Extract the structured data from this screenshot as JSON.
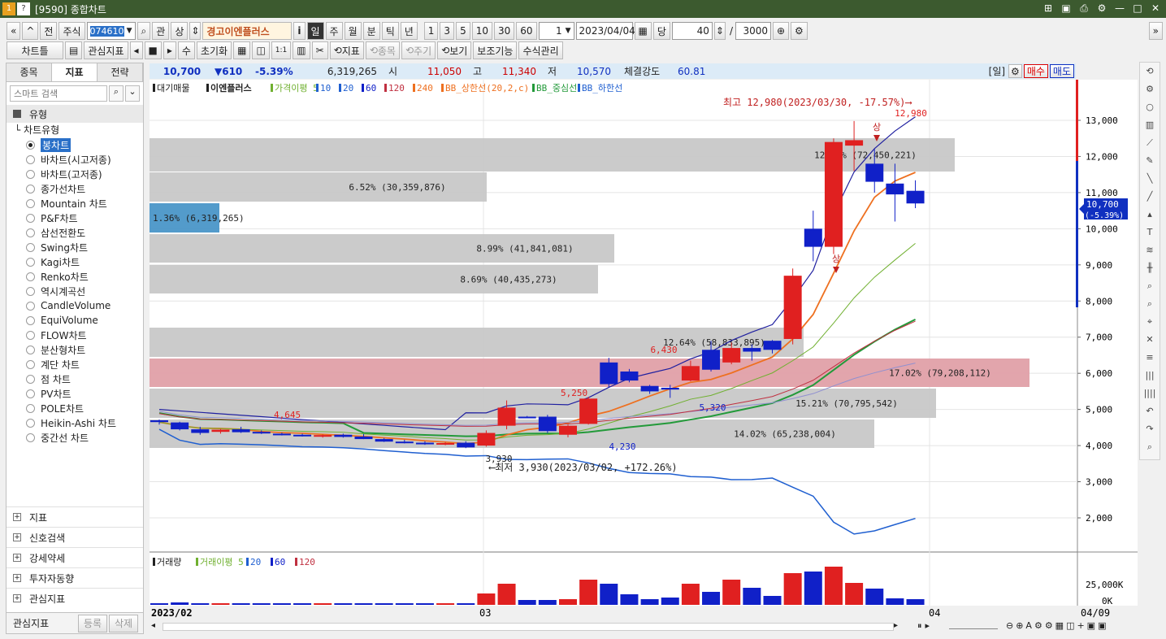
{
  "window": {
    "title": "[9590] 종합차트",
    "badge1": "1",
    "badge2": "?"
  },
  "toolbar1": {
    "nav_prev": "«",
    "nav_up": "^",
    "btn_prev": "전",
    "market": "주식",
    "code": "074610",
    "btn_search": "⌕",
    "btn_gwan": "관",
    "btn_sang": "상",
    "stock_name": "경고이엔플러스",
    "btn_info": "i",
    "periods": [
      "일",
      "주",
      "월",
      "분",
      "틱",
      "년"
    ],
    "active_period": "일",
    "intervals": [
      "1",
      "3",
      "5",
      "10",
      "30",
      "60"
    ],
    "interval_value": "1",
    "date": "2023/04/04",
    "dang": "당",
    "count": "40",
    "total": "3000"
  },
  "toolbar2": {
    "chart_type": "차트틀",
    "fav_indicator": "관심지표",
    "su": "수",
    "init": "초기화",
    "btn_11": "1:1",
    "btn_indicator": "지표",
    "btn_jongmok": "종목",
    "btn_jugi": "주기",
    "btn_view": "보기",
    "btn_aux": "보조기능",
    "btn_formula": "수식관리"
  },
  "left": {
    "tabs": [
      "종목",
      "지표",
      "전략"
    ],
    "active_tab": "지표",
    "search_placeholder": "스마트 검색",
    "group_title": "유형",
    "tree_root": "차트유형",
    "items": [
      "봉차트",
      "바차트(시고저종)",
      "바차트(고저종)",
      "종가선차트",
      "Mountain 차트",
      "P&F차트",
      "삼선전환도",
      "Swing차트",
      "Kagi차트",
      "Renko차트",
      "역시계곡선",
      "CandleVolume",
      "EquiVolume",
      "FLOW차트",
      "분산형차트",
      "계단 차트",
      "점 차트",
      "PV차트",
      "POLE차트",
      "Heikin-Ashi 차트",
      "중간선 차트"
    ],
    "selected": "봉차트",
    "groups": [
      "지표",
      "신호검색",
      "강세약세",
      "투자자동향",
      "관심지표"
    ],
    "fav_label": "관심지표",
    "fav_register": "등록",
    "fav_delete": "삭제"
  },
  "infobar": {
    "price": "10,700",
    "change": "▼610",
    "pct": "-5.39%",
    "volume": "6,319,265",
    "open_label": "시",
    "open": "11,050",
    "high_label": "고",
    "high": "11,340",
    "low_label": "저",
    "low": "10,570",
    "strength_label": "체결강도",
    "strength": "60.81",
    "period_badge": "[일]",
    "buy": "매수",
    "sell": "매도"
  },
  "legend": {
    "items": [
      "대기매물",
      "이엔플러스",
      "가격이평 5",
      "10",
      "20",
      "60",
      "120",
      "240",
      "BB_상한선(20,2,c)",
      "BB_중심선",
      "BB_하한선"
    ]
  },
  "annotations": {
    "high_text": "최고 12,980(2023/03/30, -17.57%)⟶",
    "low_text": "⟵최저 3,930(2023/03/02, +172.26%)",
    "sang": "상",
    "current_price": "10,700",
    "current_pct": "(-5.39%)"
  },
  "bars": [
    {
      "pct": "12.44% (72,450,221)",
      "v": 12.44
    },
    {
      "pct": "6.52% (30,359,876)",
      "v": 6.52
    },
    {
      "pct": "1.36% (6,319,265)",
      "v": 1.36
    },
    {
      "pct": "8.99% (41,841,081)",
      "v": 8.99
    },
    {
      "pct": "8.69% (40,435,273)",
      "v": 8.69
    },
    {
      "pct": "12.64% (58,833,895)",
      "v": 12.64
    },
    {
      "pct": "17.02% (79,208,112)",
      "v": 17.02
    },
    {
      "pct": "15.21% (70,795,542)",
      "v": 15.21
    },
    {
      "pct": "14.02% (65,238,004)",
      "v": 14.02
    }
  ],
  "price_labels": [
    "4,645",
    "5,250",
    "3,930",
    "6,430",
    "4,230",
    "5,320",
    "12,980"
  ],
  "yaxis": [
    "13,000",
    "12,000",
    "11,000",
    "10,000",
    "9,000",
    "8,000",
    "7,000",
    "6,000",
    "5,000",
    "4,000",
    "3,000",
    "2,000"
  ],
  "volume": {
    "legend": [
      "거래량",
      "거래이평 5",
      "20",
      "60",
      "120"
    ],
    "axis": [
      "25,000K",
      "0K"
    ]
  },
  "xaxis": [
    "2023/02",
    "03",
    "04",
    "04/09"
  ],
  "chart_data": {
    "type": "candlestick",
    "candles": [
      [
        4700,
        4720,
        4580,
        4650
      ],
      [
        4640,
        4660,
        4420,
        4450
      ],
      [
        4450,
        4520,
        4300,
        4350
      ],
      [
        4380,
        4460,
        4330,
        4440
      ],
      [
        4450,
        4520,
        4350,
        4370
      ],
      [
        4380,
        4420,
        4320,
        4340
      ],
      [
        4330,
        4360,
        4280,
        4300
      ],
      [
        4300,
        4330,
        4250,
        4260
      ],
      [
        4260,
        4310,
        4220,
        4290
      ],
      [
        4300,
        4330,
        4220,
        4240
      ],
      [
        4250,
        4320,
        4180,
        4180
      ],
      [
        4180,
        4210,
        4100,
        4110
      ],
      [
        4110,
        4160,
        4060,
        4080
      ],
      [
        4080,
        4120,
        4020,
        4050
      ],
      [
        4040,
        4100,
        4010,
        4070
      ],
      [
        4080,
        4120,
        3930,
        3950
      ],
      [
        4000,
        4420,
        3970,
        4350
      ],
      [
        4550,
        5250,
        4450,
        5050
      ],
      [
        4800,
        4820,
        4760,
        4780
      ],
      [
        4800,
        4850,
        4350,
        4400
      ],
      [
        4300,
        4580,
        4230,
        4550
      ],
      [
        4600,
        5350,
        4580,
        5300
      ],
      [
        6300,
        6430,
        5600,
        5700
      ],
      [
        6050,
        6120,
        5750,
        5800
      ],
      [
        5650,
        5680,
        5430,
        5500
      ],
      [
        5600,
        5680,
        5320,
        5550
      ],
      [
        5800,
        6350,
        5780,
        6200
      ],
      [
        6650,
        6900,
        6050,
        6100
      ],
      [
        6300,
        6850,
        6250,
        6700
      ],
      [
        6700,
        6800,
        6350,
        6600
      ],
      [
        6900,
        6920,
        6550,
        6650
      ],
      [
        6950,
        8900,
        6800,
        8700
      ],
      [
        10000,
        10500,
        9100,
        9500
      ],
      [
        9500,
        12500,
        9300,
        12400
      ],
      [
        12300,
        12980,
        11600,
        12450
      ],
      [
        11800,
        12200,
        11000,
        11300
      ],
      [
        11250,
        11800,
        10200,
        10950
      ],
      [
        11050,
        11340,
        10570,
        10700
      ]
    ],
    "volumes": [
      2,
      3,
      2,
      2,
      2,
      2,
      2,
      2,
      2,
      2,
      2,
      2,
      2,
      2,
      2,
      2,
      14,
      26,
      6,
      6,
      7,
      31,
      26,
      13,
      7,
      9,
      26,
      16,
      31,
      21,
      11,
      39,
      41,
      47,
      27,
      20,
      8,
      7
    ]
  }
}
